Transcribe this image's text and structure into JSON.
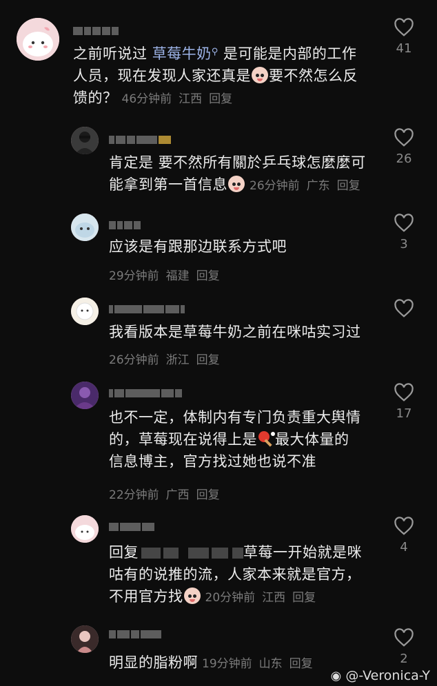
{
  "comments": [
    {
      "avatar": "pink-blob-avatar",
      "text1": "之前听说过 ",
      "link": "草莓牛奶",
      "text2": " 是可能是内部的工作",
      "line2a": "人员，现在发现人家还真是",
      "line2b": "要不然怎么反",
      "line3": "馈的？",
      "time": "46分钟前",
      "location": "江西",
      "reply": "回复",
      "likes": "41"
    },
    {
      "avatar": "dark-person-avatar",
      "line1": "肯定是 要不然所有關於乒乓球怎麼麼可",
      "line2": "能拿到第一首信息",
      "time": "26分钟前",
      "location": "广东",
      "reply": "回复",
      "likes": "26"
    },
    {
      "avatar": "cartoon-cat-avatar",
      "line1": "应该是有跟那边联系方式吧",
      "time": "29分钟前",
      "location": "福建",
      "reply": "回复",
      "likes": "3"
    },
    {
      "avatar": "white-sheep-avatar",
      "line1": "我看版本是草莓牛奶之前在咪咕实习过",
      "time": "26分钟前",
      "location": "浙江",
      "reply": "回复",
      "likes": ""
    },
    {
      "avatar": "purple-game-avatar",
      "line1": "也不一定，体制内有专门负责重大舆情",
      "line2a": "的，草莓现在说得上是",
      "line2b": "最大体量的",
      "line3": "信息博主，官方找过她也说不准",
      "time": "22分钟前",
      "location": "广西",
      "reply": "回复",
      "likes": "17"
    },
    {
      "avatar": "pink-blob-avatar",
      "line1a": "回复",
      "line1b": "草莓一开始就是咪",
      "line2": "咕有的说推的流，人家本来就是官方，",
      "line3": "不用官方找",
      "time": "20分钟前",
      "location": "江西",
      "reply": "回复",
      "likes": "4"
    },
    {
      "avatar": "anime-girl-avatar",
      "line1": "明显的脂粉啊",
      "time": "19分钟前",
      "location": "山东",
      "reply": "回复",
      "likes": "2"
    }
  ],
  "watermark": "@-Veronica-Y",
  "colors": {
    "background": "#0d0d0d",
    "text": "#ececec",
    "meta": "#7b7b7b",
    "link": "#9db4e8"
  }
}
